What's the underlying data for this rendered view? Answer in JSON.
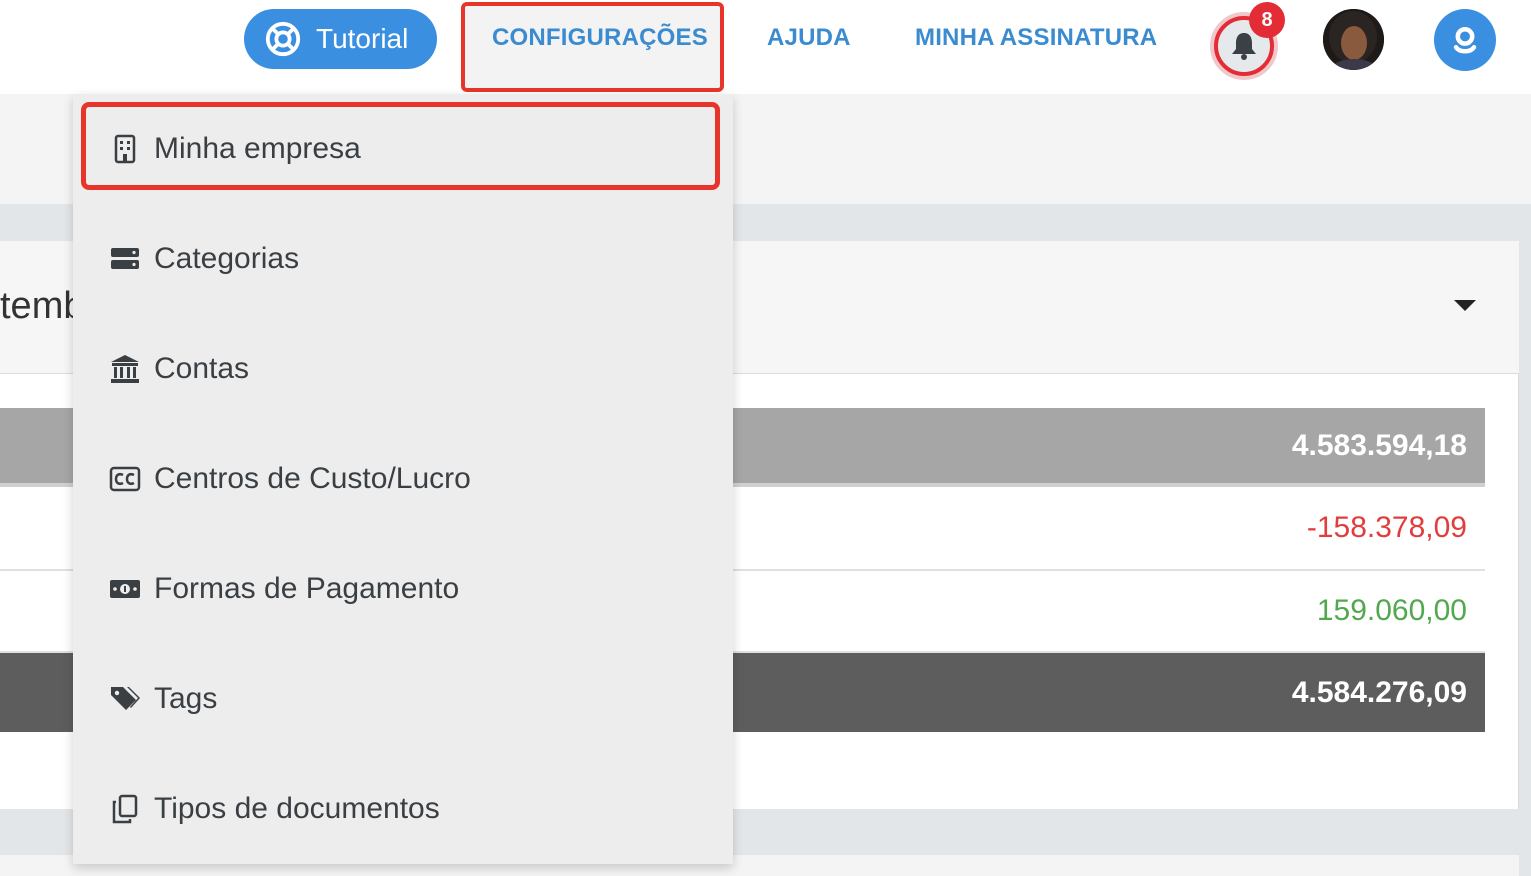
{
  "topbar": {
    "tutorial_label": "Tutorial",
    "nav": {
      "config": "CONFIGURAÇÕES",
      "help": "AJUDA",
      "subscription": "MINHA ASSINATURA"
    },
    "notification_count": "8",
    "accent_color": "#3b8fe0"
  },
  "card": {
    "title_fragment": "temb",
    "rows": [
      {
        "value": "4.583.594,18"
      },
      {
        "value": "-158.378,09"
      },
      {
        "value": "159.060,00"
      },
      {
        "value": "4.584.276,09"
      }
    ]
  },
  "dropdown": {
    "items": [
      {
        "label": "Minha empresa",
        "icon": "building-icon"
      },
      {
        "label": "Categorias",
        "icon": "server-icon"
      },
      {
        "label": "Contas",
        "icon": "bank-icon"
      },
      {
        "label": "Centros de Custo/Lucro",
        "icon": "closed-captioning-icon"
      },
      {
        "label": "Formas de Pagamento",
        "icon": "money-bill-icon"
      },
      {
        "label": "Tags",
        "icon": "tags-icon"
      },
      {
        "label": "Tipos de documentos",
        "icon": "copy-icon"
      }
    ]
  },
  "colors": {
    "negative": "#e23d3d",
    "positive": "#52a84f",
    "highlight": "#e8352b",
    "notification": "#e32c36"
  }
}
